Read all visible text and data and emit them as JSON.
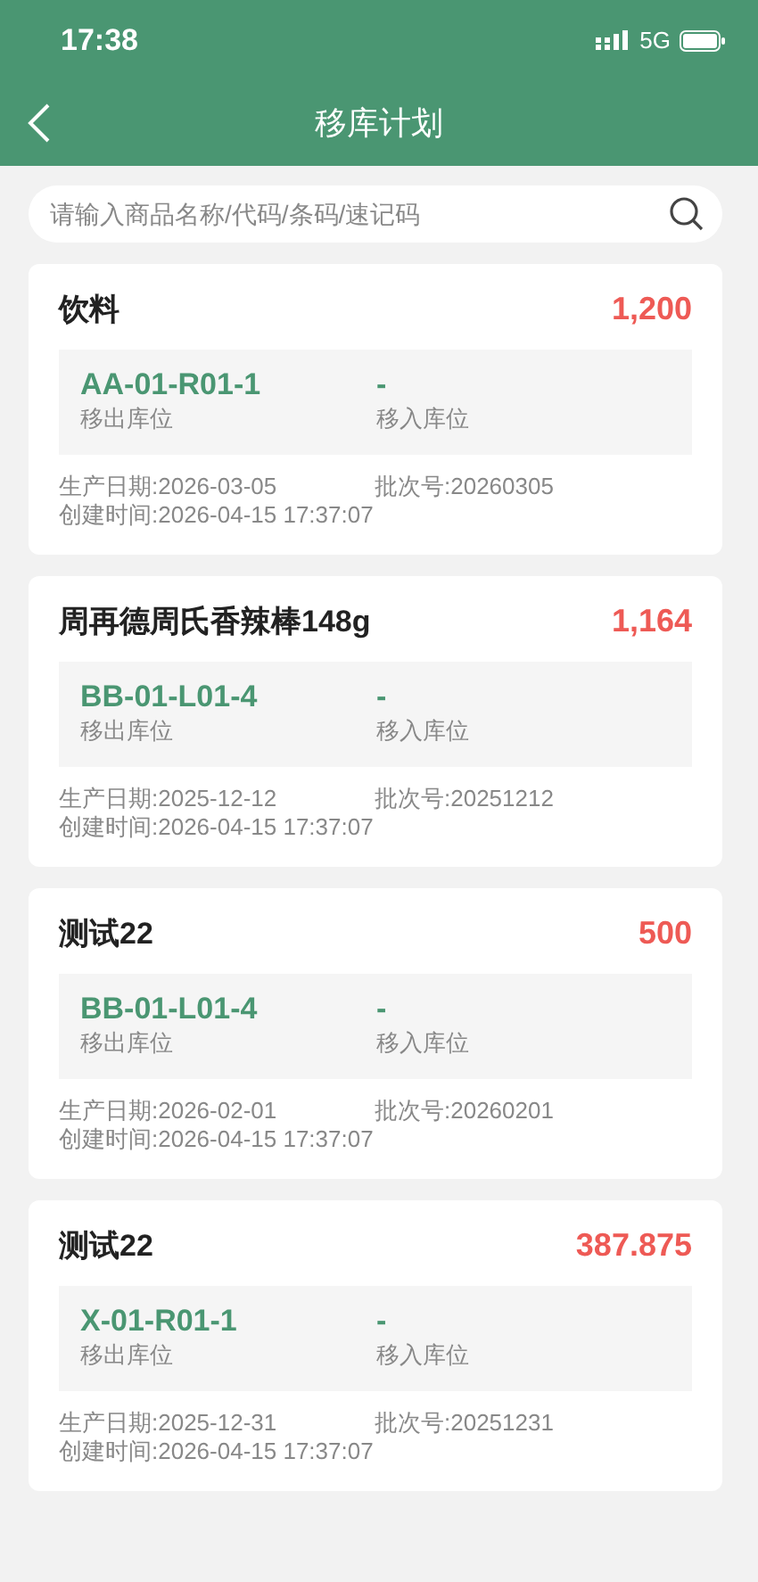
{
  "status_bar": {
    "time": "17:38",
    "network": "5G"
  },
  "nav": {
    "title": "移库计划"
  },
  "search": {
    "placeholder": "请输入商品名称/代码/条码/速记码"
  },
  "plans": [
    {
      "name": "饮料",
      "quantity": "1,200",
      "from_location": "AA-01-R01-1",
      "from_label": "移出库位",
      "to_location": "-",
      "to_label": "移入库位",
      "production_date": "生产日期:2026-03-05",
      "batch": "批次号:20260305",
      "created": "创建时间:2026-04-15 17:37:07"
    },
    {
      "name": "周再德周氏香辣棒148g",
      "quantity": "1,164",
      "from_location": "BB-01-L01-4",
      "from_label": "移出库位",
      "to_location": "-",
      "to_label": "移入库位",
      "production_date": "生产日期:2025-12-12",
      "batch": "批次号:20251212",
      "created": "创建时间:2026-04-15 17:37:07"
    },
    {
      "name": "测试22",
      "quantity": "500",
      "from_location": "BB-01-L01-4",
      "from_label": "移出库位",
      "to_location": "-",
      "to_label": "移入库位",
      "production_date": "生产日期:2026-02-01",
      "batch": "批次号:20260201",
      "created": "创建时间:2026-04-15 17:37:07"
    },
    {
      "name": "测试22",
      "quantity": "387.875",
      "from_location": "X-01-R01-1",
      "from_label": "移出库位",
      "to_location": "-",
      "to_label": "移入库位",
      "production_date": "生产日期:2025-12-31",
      "batch": "批次号:20251231",
      "created": "创建时间:2026-04-15 17:37:07"
    }
  ]
}
